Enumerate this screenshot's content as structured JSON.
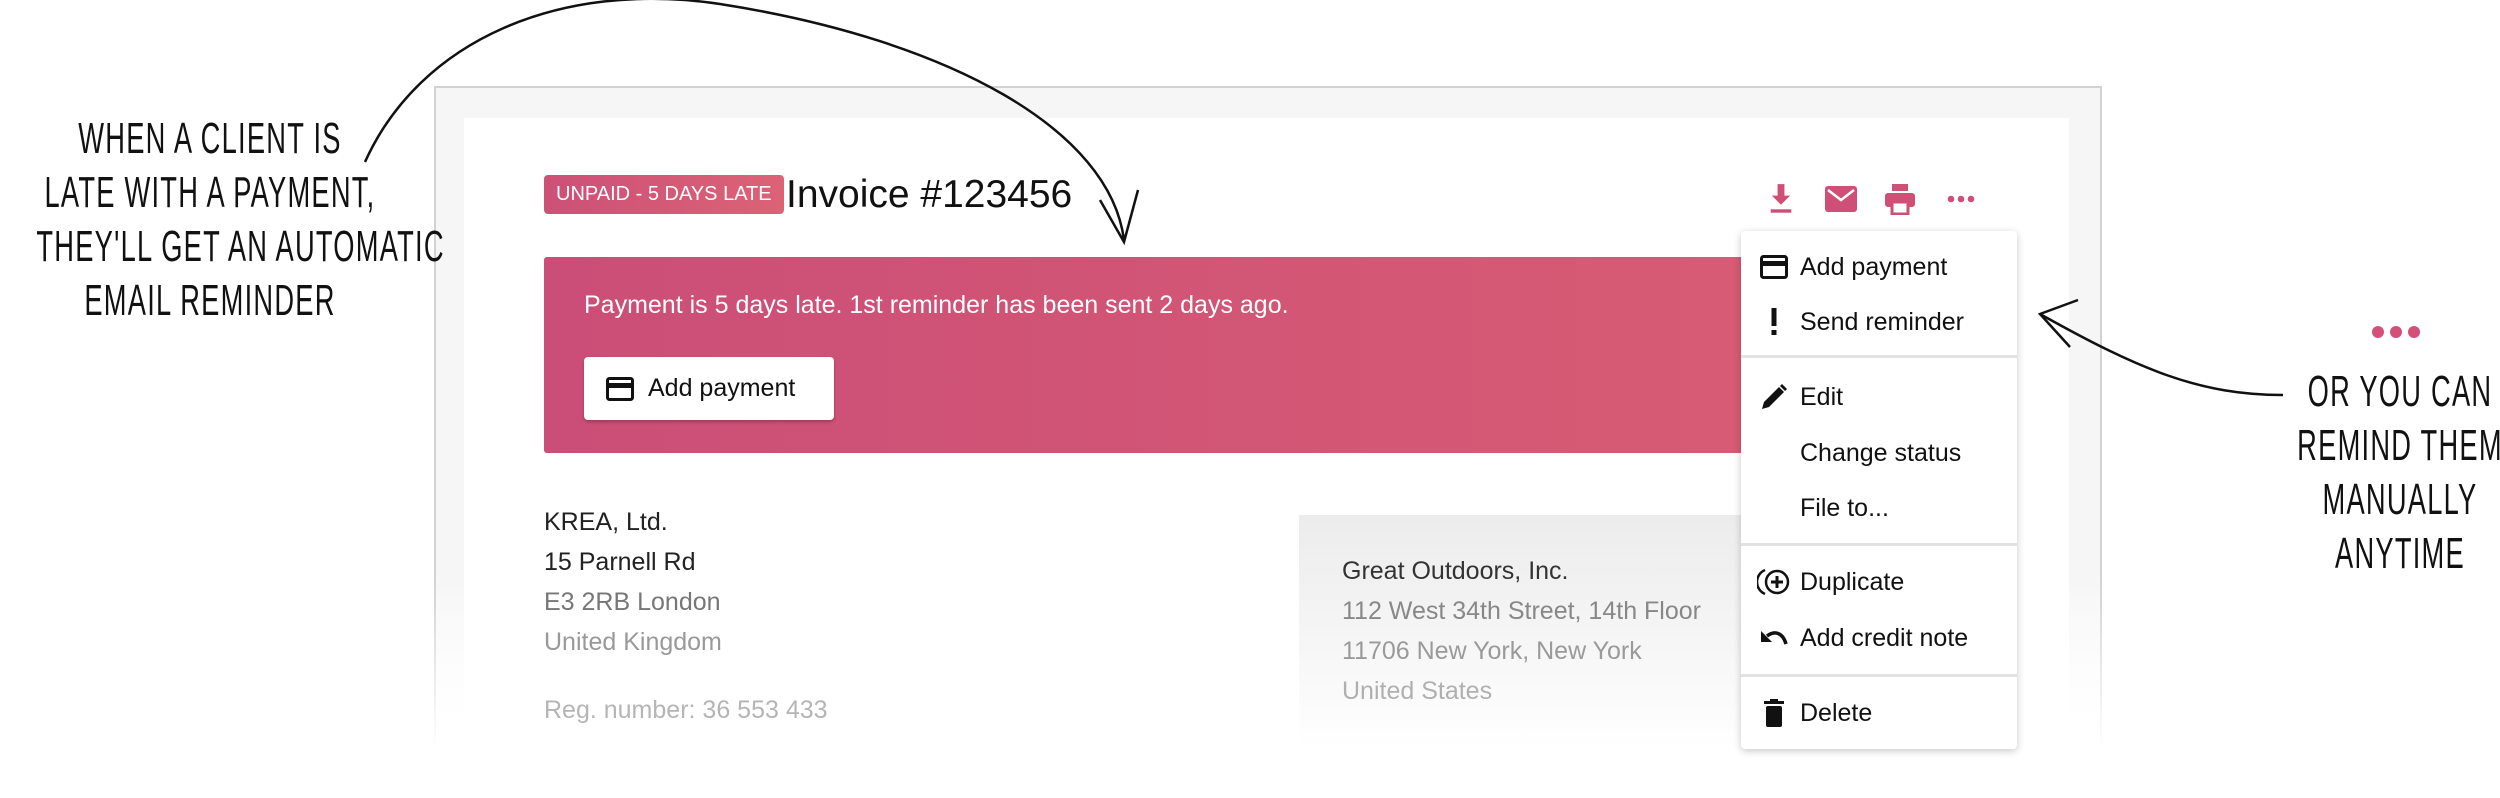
{
  "annotations": {
    "left_lines": [
      "WHEN A CLIENT IS",
      "LATE WITH A PAYMENT,",
      "THEY'LL GET AN AUTOMATIC",
      "EMAIL REMINDER"
    ],
    "right_lines": [
      "OR YOU CAN",
      "REMIND THEM",
      "MANUALLY",
      "ANYTIME"
    ]
  },
  "colors": {
    "accent": "#d4507a",
    "banner_start": "#cb4e78",
    "banner_end": "#da5e73"
  },
  "header": {
    "status_badge": "UNPAID - 5 DAYS LATE",
    "title": "Invoice #123456",
    "toolbar_icons": [
      "download-icon",
      "mail-icon",
      "print-icon",
      "more-icon"
    ]
  },
  "banner": {
    "message": "Payment is 5 days late. 1st reminder has been sent 2 days ago.",
    "button_label": "Add payment"
  },
  "sender": {
    "lines": [
      "KREA, Ltd.",
      "15 Parnell Rd",
      "E3 2RB London",
      "United Kingdom"
    ],
    "reg": "Reg. number: 36 553 433"
  },
  "client": {
    "lines": [
      "Great Outdoors, Inc.",
      "112 West 34th Street, 14th Floor",
      "11706 New York, New York",
      "United States"
    ]
  },
  "menu": {
    "items": [
      {
        "label": "Add payment",
        "icon": "credit-card-icon"
      },
      {
        "label": "Send reminder",
        "icon": "exclamation-icon"
      },
      {
        "label": "Edit",
        "icon": "pencil-icon"
      },
      {
        "label": "Change status",
        "icon": ""
      },
      {
        "label": "File to...",
        "icon": ""
      },
      {
        "label": "Duplicate",
        "icon": "duplicate-icon"
      },
      {
        "label": "Add credit note",
        "icon": "undo-icon"
      },
      {
        "label": "Delete",
        "icon": "trash-icon"
      }
    ]
  }
}
